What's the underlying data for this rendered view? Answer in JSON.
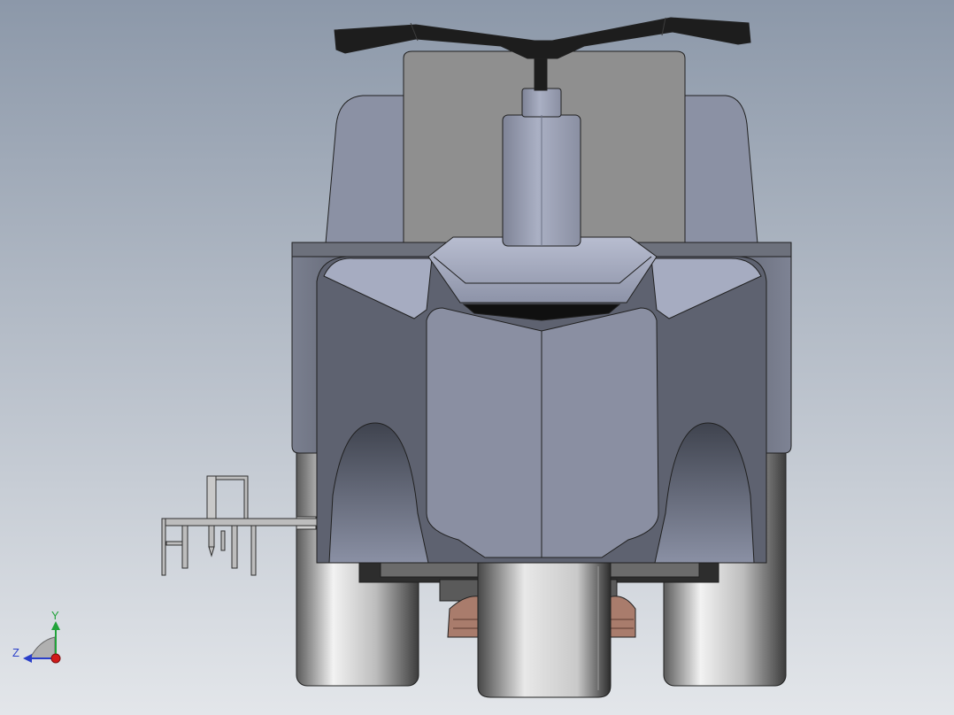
{
  "viewport": {
    "background_top": "#8c98a9",
    "background_bottom": "#e3e6ea"
  },
  "triad": {
    "y_label": "Y",
    "z_label": "Z",
    "y_color": "#22a33a",
    "z_color": "#2a3fc9",
    "x_color": "#d11a1a"
  },
  "colors": {
    "body_blue": "#9ca3bc",
    "body_shadow": "#606575",
    "fender_dark": "#5d6066",
    "tire_light": "#ececec",
    "tire_dark": "#4b4b4b",
    "seat_gray": "#8f8f8f",
    "handlebar": "#1d1d1d",
    "pedal_brown": "#a97c6c",
    "outline": "#202020"
  }
}
